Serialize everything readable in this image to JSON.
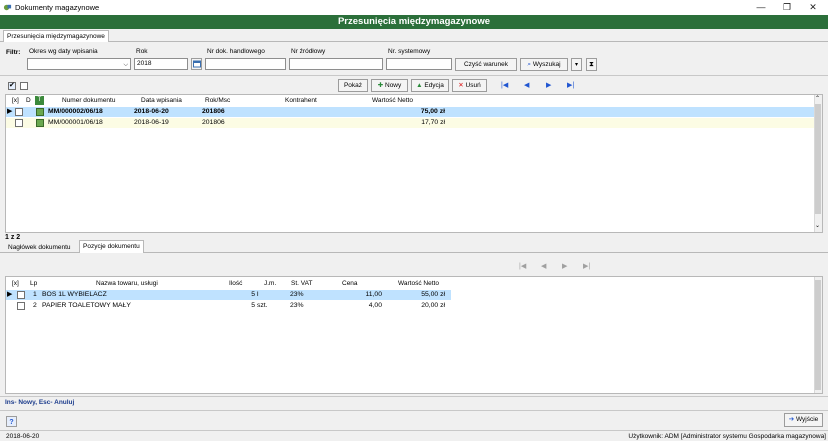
{
  "window": {
    "title": "Dokumenty magazynowe",
    "minimize": "—",
    "maximize": "❐",
    "close": "✕"
  },
  "banner": "Przesunięcia międzymagazynowe",
  "tabs": {
    "main": "Przesunięcia międzymagazynowe"
  },
  "filter": {
    "label": "Filtr:",
    "period_label": "Okres wg daty wpisania",
    "year_label": "Rok",
    "year_value": "2018",
    "trade_doc_label": "Nr dok. handlowego",
    "source_label": "Nr źródłowy",
    "system_label": "Nr. systemowy",
    "clear_button": "Czyść warunek",
    "search_button": "Wyszukaj"
  },
  "toolbar": {
    "show": "Pokaż",
    "new": "Nowy",
    "edit": "Edycja",
    "delete": "Usuń",
    "first": "|◀",
    "prev": "◀",
    "next": "▶",
    "last": "▶|"
  },
  "documents": {
    "headers": {
      "x": "[x]",
      "d": "D",
      "t": "T",
      "number": "Numer dokumentu",
      "date": "Data wpisania",
      "period": "Rok/Msc",
      "contractor": "Kontrahent",
      "net": "Wartość Netto"
    },
    "rows": [
      {
        "number": "MM/000002/06/18",
        "date": "2018-06-20",
        "period": "201806",
        "contractor": "",
        "net": "75,00 zł"
      },
      {
        "number": "MM/000001/06/18",
        "date": "2018-06-19",
        "period": "201806",
        "contractor": "",
        "net": "17,70 zł"
      }
    ],
    "count": "1 z 2"
  },
  "subtabs": {
    "header": "Nagłówek dokumentu",
    "items": "Pozycje dokumentu"
  },
  "items": {
    "headers": {
      "x": "[x]",
      "lp": "Lp",
      "name": "Nazwa towaru, usługi",
      "qty": "Ilość",
      "unit": "J.m.",
      "vat": "St. VAT",
      "price": "Cena",
      "net": "Wartość Netto"
    },
    "rows": [
      {
        "lp": "1",
        "name": "BOS 1L WYBIELACZ",
        "qty": "5",
        "unit": "l",
        "vat": "23%",
        "price": "11,00",
        "net": "55,00 zł"
      },
      {
        "lp": "2",
        "name": "PAPIER TOALETOWY MAŁY",
        "qty": "5",
        "unit": "szt.",
        "vat": "23%",
        "price": "4,00",
        "net": "20,00 zł"
      }
    ]
  },
  "hint": "Ins- Nowy, Esc- Anuluj",
  "exit_button": "Wyjście",
  "statusbar": {
    "date": "2018-06-20",
    "user": "Użytkownik: ADM [Administrator systemu Gospodarka magazynowa]"
  },
  "colors": {
    "banner": "#2b6f3a",
    "selection": "#bfe2ff",
    "alt_row": "#fcfce4"
  }
}
